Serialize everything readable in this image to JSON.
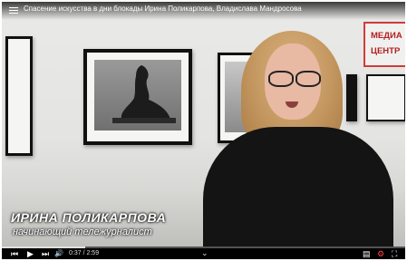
{
  "player": {
    "title": "Спасение искусства в дни блокады   Ирина Поликарпова, Владислава Мандросова",
    "logo_line1": "МЕДИА",
    "logo_line2": "ЦЕНТР",
    "lower_third_name": "ИРИНА ПОЛИКАРПОВА",
    "lower_third_role": "начинающий тележурналист",
    "time": "0:37 / 2:59",
    "progress": 0.206
  },
  "icons": {
    "menu": "≡",
    "skip_back": "⏮",
    "play": "▶",
    "skip_forward": "⏭",
    "volume": "🔊",
    "chevron": "⌄",
    "subtitles": "▤",
    "settings": "⚙",
    "fullscreen": "⛶"
  },
  "colors": {
    "logo_accent": "#d23b3b"
  }
}
